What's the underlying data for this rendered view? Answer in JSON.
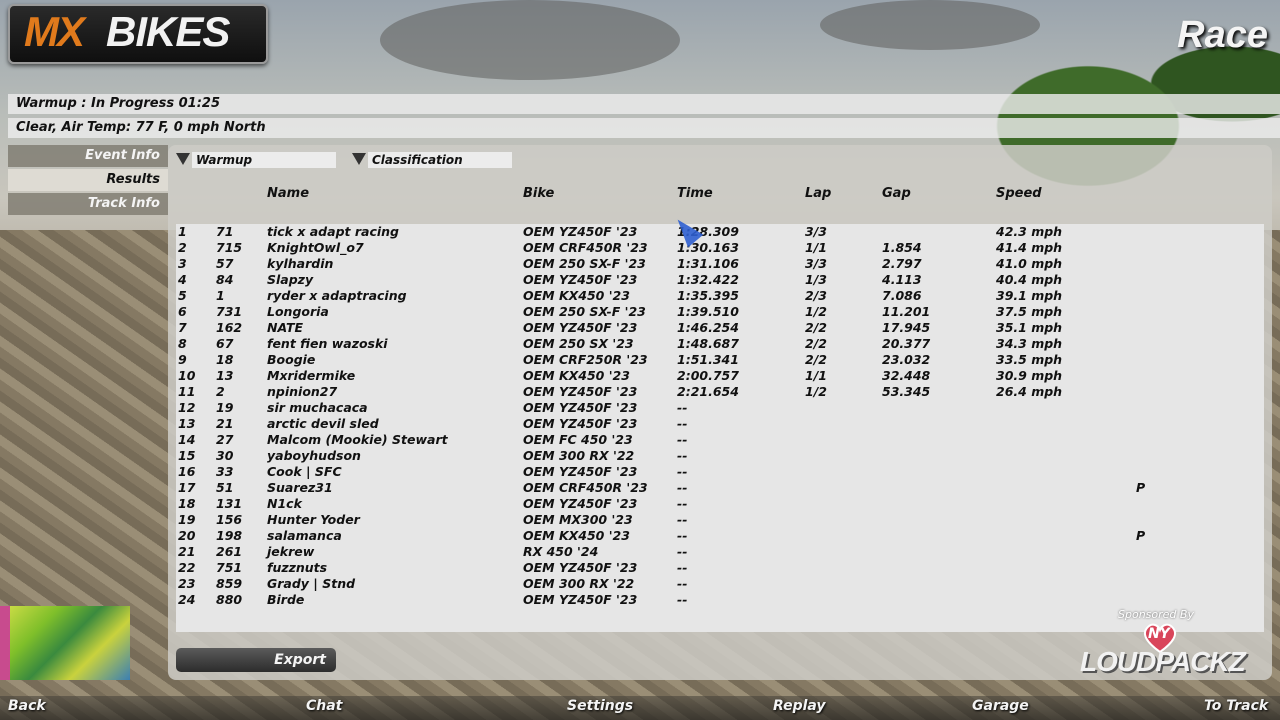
{
  "header": {
    "logo_mx": "MX",
    "logo_bikes": "BIKES",
    "title": "Race"
  },
  "status": {
    "session": "Warmup : In Progress  01:25",
    "weather": "Clear, Air Temp: 77 F, 0 mph North"
  },
  "nav": {
    "event_info": "Event Info",
    "results": "Results",
    "track_info": "Track Info"
  },
  "dropdowns": {
    "session": "Warmup",
    "view": "Classification"
  },
  "columns": {
    "name": "Name",
    "bike": "Bike",
    "time": "Time",
    "lap": "Lap",
    "gap": "Gap",
    "speed": "Speed"
  },
  "rows": [
    {
      "pos": "1",
      "num": "71",
      "name": "tick x adapt racing",
      "bike": "OEM YZ450F '23",
      "time": "1:28.309",
      "lap": "3/3",
      "gap": "",
      "speed": "42.3 mph",
      "flag": ""
    },
    {
      "pos": "2",
      "num": "715",
      "name": "KnightOwl_o7",
      "bike": "OEM CRF450R '23",
      "time": "1:30.163",
      "lap": "1/1",
      "gap": "1.854",
      "speed": "41.4 mph",
      "flag": ""
    },
    {
      "pos": "3",
      "num": "57",
      "name": "kylhardin",
      "bike": "OEM 250 SX-F '23",
      "time": "1:31.106",
      "lap": "3/3",
      "gap": "2.797",
      "speed": "41.0 mph",
      "flag": ""
    },
    {
      "pos": "4",
      "num": "84",
      "name": "Slapzy",
      "bike": "OEM YZ450F '23",
      "time": "1:32.422",
      "lap": "1/3",
      "gap": "4.113",
      "speed": "40.4 mph",
      "flag": ""
    },
    {
      "pos": "5",
      "num": "1",
      "name": "ryder x adaptracing",
      "bike": "OEM KX450 '23",
      "time": "1:35.395",
      "lap": "2/3",
      "gap": "7.086",
      "speed": "39.1 mph",
      "flag": ""
    },
    {
      "pos": "6",
      "num": "731",
      "name": "Longoria",
      "bike": "OEM 250 SX-F '23",
      "time": "1:39.510",
      "lap": "1/2",
      "gap": "11.201",
      "speed": "37.5 mph",
      "flag": ""
    },
    {
      "pos": "7",
      "num": "162",
      "name": "NATE",
      "bike": "OEM YZ450F '23",
      "time": "1:46.254",
      "lap": "2/2",
      "gap": "17.945",
      "speed": "35.1 mph",
      "flag": ""
    },
    {
      "pos": "8",
      "num": "67",
      "name": "fent fien wazoski",
      "bike": "OEM 250 SX '23",
      "time": "1:48.687",
      "lap": "2/2",
      "gap": "20.377",
      "speed": "34.3 mph",
      "flag": ""
    },
    {
      "pos": "9",
      "num": "18",
      "name": "Boogie",
      "bike": "OEM CRF250R '23",
      "time": "1:51.341",
      "lap": "2/2",
      "gap": "23.032",
      "speed": "33.5 mph",
      "flag": ""
    },
    {
      "pos": "10",
      "num": "13",
      "name": "Mxridermike",
      "bike": "OEM KX450 '23",
      "time": "2:00.757",
      "lap": "1/1",
      "gap": "32.448",
      "speed": "30.9 mph",
      "flag": ""
    },
    {
      "pos": "11",
      "num": "2",
      "name": "npinion27",
      "bike": "OEM YZ450F '23",
      "time": "2:21.654",
      "lap": "1/2",
      "gap": "53.345",
      "speed": "26.4 mph",
      "flag": ""
    },
    {
      "pos": "12",
      "num": "19",
      "name": "sir muchacaca",
      "bike": "OEM YZ450F '23",
      "time": "--",
      "lap": "",
      "gap": "",
      "speed": "",
      "flag": ""
    },
    {
      "pos": "13",
      "num": "21",
      "name": "arctic devil sled",
      "bike": "OEM YZ450F '23",
      "time": "--",
      "lap": "",
      "gap": "",
      "speed": "",
      "flag": ""
    },
    {
      "pos": "14",
      "num": "27",
      "name": "Malcom (Mookie) Stewart",
      "bike": "OEM FC 450 '23",
      "time": "--",
      "lap": "",
      "gap": "",
      "speed": "",
      "flag": ""
    },
    {
      "pos": "15",
      "num": "30",
      "name": "yaboyhudson",
      "bike": "OEM 300 RX '22",
      "time": "--",
      "lap": "",
      "gap": "",
      "speed": "",
      "flag": ""
    },
    {
      "pos": "16",
      "num": "33",
      "name": "Cook | SFC",
      "bike": "OEM YZ450F '23",
      "time": "--",
      "lap": "",
      "gap": "",
      "speed": "",
      "flag": ""
    },
    {
      "pos": "17",
      "num": "51",
      "name": "Suarez31",
      "bike": "OEM CRF450R '23",
      "time": "--",
      "lap": "",
      "gap": "",
      "speed": "",
      "flag": "P"
    },
    {
      "pos": "18",
      "num": "131",
      "name": "N1ck",
      "bike": "OEM YZ450F '23",
      "time": "--",
      "lap": "",
      "gap": "",
      "speed": "",
      "flag": ""
    },
    {
      "pos": "19",
      "num": "156",
      "name": "Hunter Yoder",
      "bike": "OEM MX300 '23",
      "time": "--",
      "lap": "",
      "gap": "",
      "speed": "",
      "flag": ""
    },
    {
      "pos": "20",
      "num": "198",
      "name": "salamanca",
      "bike": "OEM KX450 '23",
      "time": "--",
      "lap": "",
      "gap": "",
      "speed": "",
      "flag": "P"
    },
    {
      "pos": "21",
      "num": "261",
      "name": "jekrew",
      "bike": "RX 450 '24",
      "time": "--",
      "lap": "",
      "gap": "",
      "speed": "",
      "flag": ""
    },
    {
      "pos": "22",
      "num": "751",
      "name": "fuzznuts",
      "bike": "OEM YZ450F '23",
      "time": "--",
      "lap": "",
      "gap": "",
      "speed": "",
      "flag": ""
    },
    {
      "pos": "23",
      "num": "859",
      "name": "Grady | Stnd",
      "bike": "OEM 300 RX '22",
      "time": "--",
      "lap": "",
      "gap": "",
      "speed": "",
      "flag": ""
    },
    {
      "pos": "24",
      "num": "880",
      "name": "Birde",
      "bike": "OEM YZ450F '23",
      "time": "--",
      "lap": "",
      "gap": "",
      "speed": "",
      "flag": ""
    }
  ],
  "buttons": {
    "export": "Export"
  },
  "bottom": {
    "back": "Back",
    "chat": "Chat",
    "settings": "Settings",
    "replay": "Replay",
    "garage": "Garage",
    "to_track": "To Track"
  },
  "sponsor": {
    "sponsored_by": "Sponsored By",
    "ny": "NY",
    "name": "LOUDPACKZ"
  }
}
